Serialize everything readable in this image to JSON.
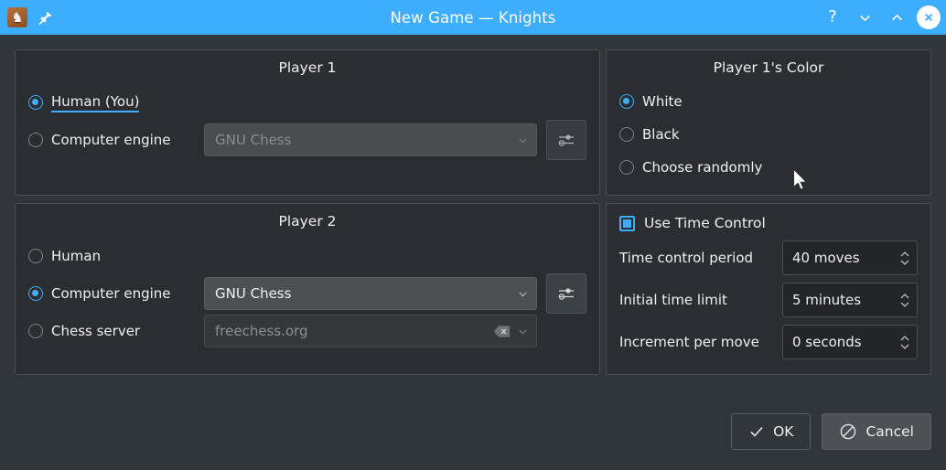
{
  "titlebar": {
    "app_icon": "chess-knight-icon",
    "pin_icon": "pin-icon",
    "title": "New Game — Knights",
    "help_label": "?",
    "minimize_icon": "chevron-down-icon",
    "maximize_icon": "chevron-up-icon",
    "close_icon": "close-icon",
    "bg_color": "#3daefd"
  },
  "player1": {
    "title": "Player 1",
    "human_label": "Human (You)",
    "human_selected": true,
    "engine_label": "Computer engine",
    "engine_selected": false,
    "engine_combo_value": "GNU Chess",
    "engine_combo_disabled": true,
    "config_button_icon": "sliders-icon"
  },
  "player2": {
    "title": "Player 2",
    "human_label": "Human",
    "human_selected": false,
    "engine_label": "Computer engine",
    "engine_selected": true,
    "engine_combo_value": "GNU Chess",
    "engine_combo_disabled": false,
    "config_button_icon": "sliders-icon",
    "server_label": "Chess server",
    "server_selected": false,
    "server_combo_value": "freechess.org",
    "server_combo_disabled": true,
    "server_clear_icon": "clear-text-icon"
  },
  "color_group": {
    "title": "Player 1's Color",
    "options": [
      {
        "label": "White",
        "selected": true
      },
      {
        "label": "Black",
        "selected": false
      },
      {
        "label": "Choose randomly",
        "selected": false
      }
    ]
  },
  "time_control": {
    "use_label": "Use Time Control",
    "use_checked": true,
    "fields": [
      {
        "label": "Time control period",
        "value": "40 moves"
      },
      {
        "label": "Initial time limit",
        "value": "5 minutes"
      },
      {
        "label": "Increment per move",
        "value": "0 seconds"
      }
    ]
  },
  "buttons": {
    "ok_label": "OK",
    "ok_icon": "check-icon",
    "cancel_label": "Cancel",
    "cancel_icon": "no-entry-icon"
  },
  "theme": {
    "accent": "#3daefd",
    "window_bg": "#31363b",
    "group_bg": "#2a2e32",
    "field_bg": "#232629",
    "combo_bg": "#4d4f51",
    "text": "#eff0f1",
    "text_disabled": "#8a8e91"
  }
}
